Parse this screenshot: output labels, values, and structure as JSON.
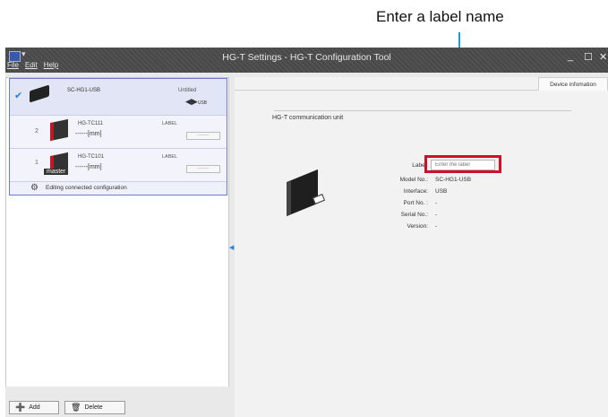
{
  "annotation": {
    "text": "Enter a label name"
  },
  "window": {
    "title": "HG-T Settings - HG-T Configuration Tool",
    "dropdown_glyph": "▾",
    "minimize": "_",
    "maximize": "☐",
    "close": "✕"
  },
  "menu": [
    "File",
    "Edit",
    "Help"
  ],
  "tree": {
    "usb": {
      "name": "SC-HG1-USB",
      "status": "Untitled",
      "conn_symbol": "◀▶",
      "conn_label": "USB"
    },
    "sensors": [
      {
        "index": "2",
        "model": "HG-TC111",
        "value": "------[mm]",
        "label_header": "LABEL",
        "label_value": "--------"
      },
      {
        "index": "1",
        "model": "HG-TC101",
        "value": "------[mm]",
        "label_header": "LABEL",
        "label_value": "--------",
        "badge": "master"
      }
    ],
    "edit_text": "Editing connected configuration"
  },
  "buttons": {
    "add": "Add",
    "delete": "Delete"
  },
  "tab": {
    "label": "Device infomation"
  },
  "device": {
    "heading": "HG-T communication unit",
    "fields": [
      {
        "label": "Label:",
        "placeholder": "Enter the label"
      },
      {
        "label": "Model No.:",
        "value": "SC-HG1-USB"
      },
      {
        "label": "Interface:",
        "value": "USB"
      },
      {
        "label": "Port No. :",
        "value": "-"
      },
      {
        "label": "Serial No.:",
        "value": "-"
      },
      {
        "label": "Version:",
        "value": "-"
      }
    ]
  },
  "colors": {
    "accent": "#1a9ee0",
    "highlight": "#d0102a",
    "titlebar": "#4b4b4b"
  }
}
